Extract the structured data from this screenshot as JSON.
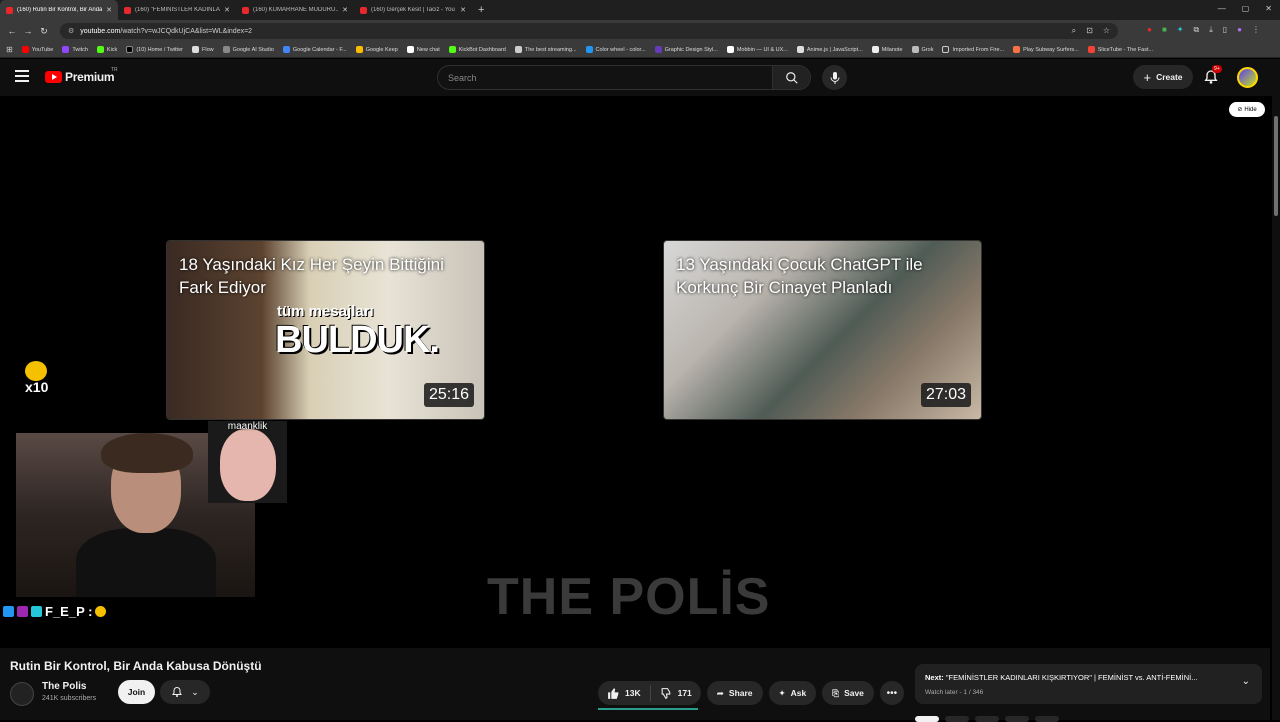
{
  "browser": {
    "tabs": [
      {
        "title": "(160) Rutin Bir Kontrol, Bir Anda",
        "active": true
      },
      {
        "title": "(160) \"FEMİNİSTLER KADINLAR...",
        "active": false
      },
      {
        "title": "(160) KUMARHANE MÜDÜRÜ...",
        "active": false
      },
      {
        "title": "(160) Gerçek Kesit | Taciz - YouT...",
        "active": false
      }
    ],
    "url_host": "youtube.com",
    "url_path": "/watch?v=wJCQdkUjCA&list=WL&index=2",
    "bookmarks": [
      "YouTube",
      "Twitch",
      "Kick",
      "(10) Home / Twitter",
      "Flow",
      "Google AI Studio",
      "Google Calendar - F...",
      "Google Keep",
      "New chat",
      "KickBot Dashboard",
      "The best streaming...",
      "Color wheel - color...",
      "Graphic Design Styl...",
      "Mobbin — UI & UX...",
      "Anime.js | JavaScript...",
      "Milanote",
      "Grok",
      "Imported From Fire...",
      "Play Subway Surfers...",
      "SliceTube - The Fast..."
    ]
  },
  "header": {
    "logo_text": "Premium",
    "region": "TR",
    "search_placeholder": "Search",
    "create_label": "Create",
    "notif_badge": "9+"
  },
  "video": {
    "hide_label": "Hide",
    "endcards": [
      {
        "title": "18 Yaşındaki Kız Her Şeyin Bittiğini Fark Ediyor",
        "duration": "25:16",
        "overlay_small": "tüm mesajları",
        "overlay_big": "BULDUK."
      },
      {
        "title": "13 Yaşındaki Çocuk ChatGPT ile Korkunç Bir Cinayet Planladı",
        "duration": "27:03"
      }
    ],
    "watermark": "THE POLİS",
    "facecam_label": "maanklik",
    "emote_count": "x10",
    "chat_text": "F_E_P :"
  },
  "info": {
    "title": "Rutin Bir Kontrol, Bir Anda Kabusa Dönüştü",
    "channel_name": "The Polis",
    "subscribers": "241K subscribers",
    "join_label": "Join",
    "likes": "13K",
    "dislikes": "171",
    "share_label": "Share",
    "ask_label": "Ask",
    "save_label": "Save"
  },
  "playlist": {
    "next_prefix": "Next:",
    "next_title": "\"FEMİNİSTLER KADINLARI KIŞKIRTIYOR\" | FEMİNİST vs. ANTİ-FEMİNİ...",
    "meta": "Watch later - 1 / 346"
  },
  "colors": {
    "yt_red": "#ff0000",
    "badge_red": "#cc0000",
    "like_underline": "#2a9d8f"
  }
}
